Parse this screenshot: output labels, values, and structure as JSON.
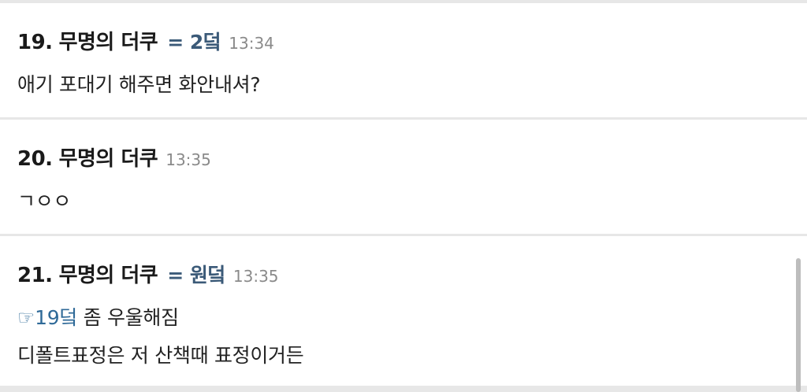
{
  "posts": [
    {
      "number": "19.",
      "author": "무명의 더쿠",
      "tag": "= 2덬",
      "time": "13:34",
      "lines": [
        "애기 포대기 해주면 화안내셔?"
      ]
    },
    {
      "number": "20.",
      "author": "무명의 더쿠",
      "tag": "",
      "time": "13:35",
      "lines": [
        "ㄱㅇㅇ"
      ]
    },
    {
      "number": "21.",
      "author": "무명의 더쿠",
      "tag": "= 원덬",
      "time": "13:35",
      "reply": {
        "link": "☞19덬",
        "text": " 좀 우울해짐"
      },
      "lines": [
        "디폴트표정은 저 산책때 표정이거든"
      ]
    }
  ],
  "colors": {
    "page_bg": "#e7e7e7",
    "post_bg": "#ffffff",
    "tag": "#3b5a78",
    "reply_link": "#2f6a98",
    "time": "#8a8a8a"
  }
}
